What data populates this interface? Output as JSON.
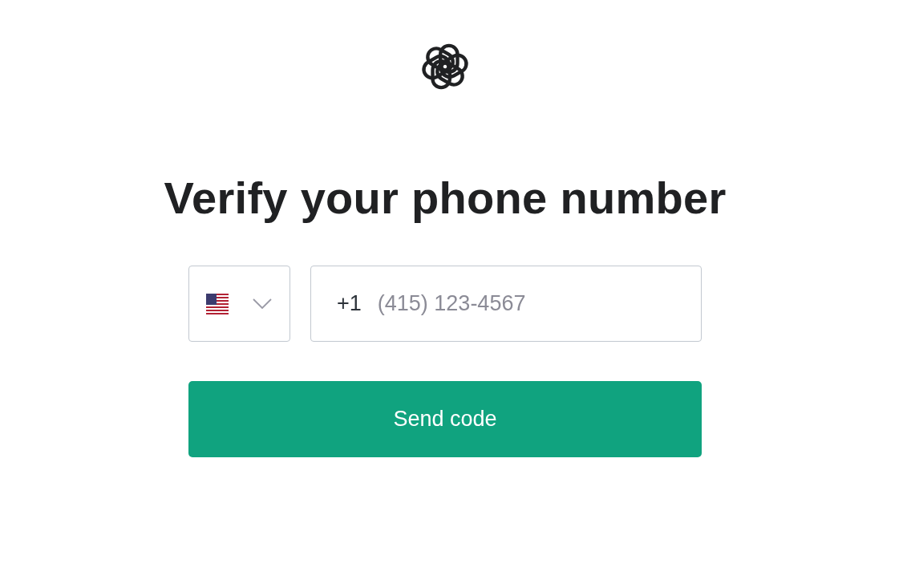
{
  "heading": "Verify your phone number",
  "phone": {
    "country_code": "+1",
    "placeholder": "(415) 123-4567"
  },
  "button": {
    "label": "Send code"
  }
}
